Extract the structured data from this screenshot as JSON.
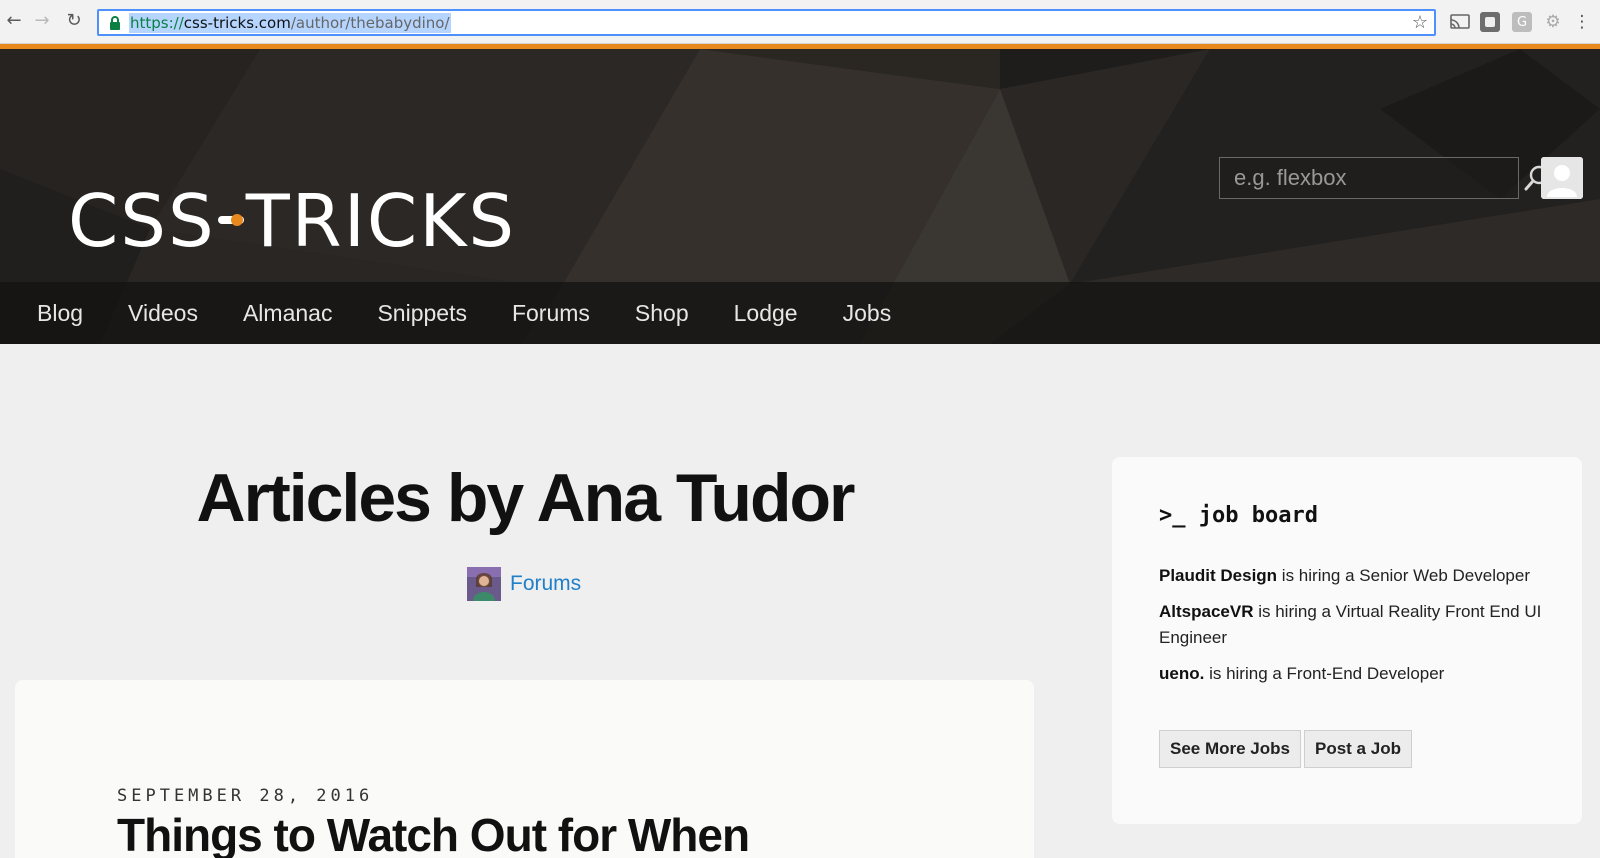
{
  "browser": {
    "url_scheme": "https://",
    "url_host": "css-tricks.com",
    "url_path": "/author/thebabydino/",
    "back_icon": "arrow-left",
    "forward_icon": "arrow-right",
    "reload_icon": "reload",
    "star_icon": "star",
    "extension_icons": [
      "cast-icon",
      "extension-icon",
      "grammarly-icon",
      "settings-extension-icon",
      "menu-dots-icon"
    ]
  },
  "header": {
    "logo_left": "CSS",
    "logo_right": "TRICKS",
    "search_placeholder": "e.g. flexbox",
    "accent_color": "#e8891e"
  },
  "nav": {
    "items": [
      "Blog",
      "Videos",
      "Almanac",
      "Snippets",
      "Forums",
      "Shop",
      "Lodge",
      "Jobs"
    ]
  },
  "author": {
    "page_title": "Articles by Ana Tudor",
    "forums_link": "Forums"
  },
  "article": {
    "date": "SEPTEMBER 28, 2016",
    "title": "Things to Watch Out for When"
  },
  "job_board": {
    "heading": ">_ job board",
    "jobs": [
      {
        "company": "Plaudit Design",
        "text": " is hiring a Senior Web Developer"
      },
      {
        "company": "AltspaceVR",
        "text": " is hiring a Virtual Reality Front End UI Engineer"
      },
      {
        "company": "ueno.",
        "text": " is hiring a Front-End Developer"
      }
    ],
    "see_more_label": "See More Jobs",
    "post_job_label": "Post a Job"
  }
}
